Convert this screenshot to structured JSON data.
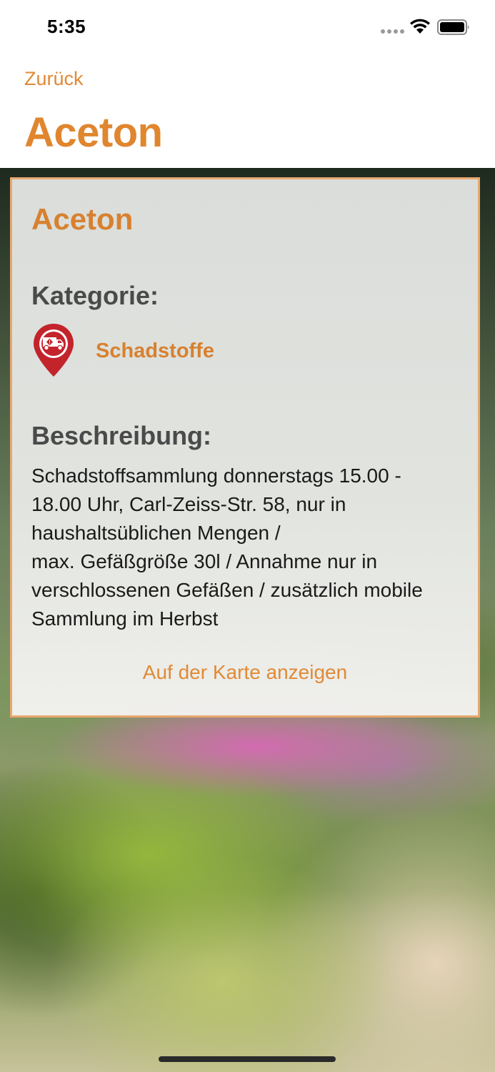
{
  "status_bar": {
    "time": "5:35",
    "icons": [
      "signal-dots-icon",
      "wifi-icon",
      "battery-icon"
    ]
  },
  "navbar": {
    "back_label": "Zurück",
    "title": "Aceton"
  },
  "card": {
    "title": "Aceton",
    "category_heading": "Kategorie:",
    "category_icon": "hazmat-truck-pin-icon",
    "category_label": "Schadstoffe",
    "description_heading": "Beschreibung:",
    "description": "Schadstoffsammlung donnerstags 15.00 -\n18.00 Uhr, Carl-Zeiss-Str. 58, nur in\nhaushaltsüblichen Mengen /\nmax. Gefäßgröße 30l / Annahme nur in\nverschlossenen Gefäßen / zusätzlich mobile\nSammlung im Herbst",
    "map_button_label": "Auf der Karte anzeigen"
  },
  "colors": {
    "accent": "#e08a35",
    "heading_gray": "#4a4a4a",
    "card_border": "#e7a86e",
    "pin_red": "#c3242c"
  }
}
